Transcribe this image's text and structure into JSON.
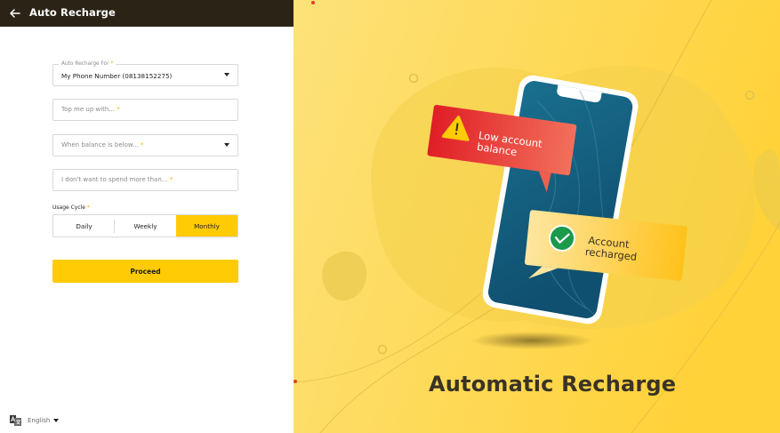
{
  "header": {
    "title": "Auto Recharge"
  },
  "form": {
    "recharge_for": {
      "label": "Auto Recharge For",
      "value": "My Phone Number (08138152275)"
    },
    "top_up": {
      "placeholder": "Top me up with..."
    },
    "balance": {
      "placeholder": "When balance is below..."
    },
    "spend_limit": {
      "placeholder": "I don't want to spend more than..."
    },
    "usage_cycle": {
      "label": "Usage Cycle",
      "options": [
        "Daily",
        "Weekly",
        "Monthly"
      ],
      "selected": "Monthly"
    },
    "required_mark": "*",
    "proceed_label": "Proceed"
  },
  "footer": {
    "language": "English"
  },
  "hero": {
    "title": "Automatic Recharge",
    "alert_line1": "Low account",
    "alert_line2": "balance",
    "success_line1": "Account",
    "success_line2": "recharged"
  },
  "colors": {
    "accent": "#ffcb05",
    "header_bg": "#2b2416",
    "alert": "#e8262d",
    "success": "#1a9a4a"
  }
}
